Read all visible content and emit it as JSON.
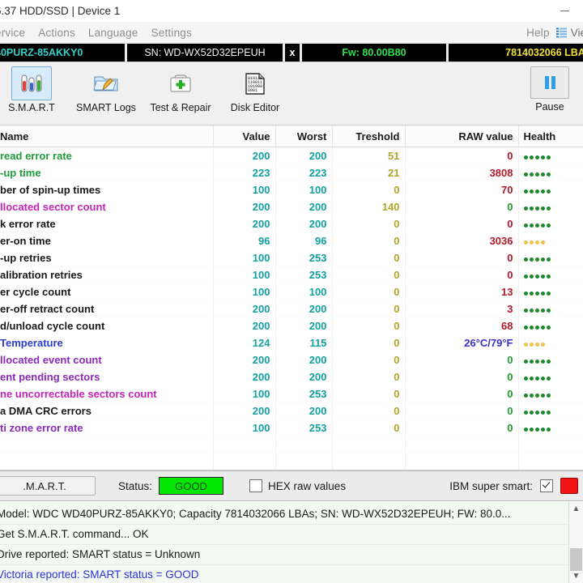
{
  "window": {
    "title": "6.37 HDD/SSD | Device 1",
    "minimize_glyph": "minimize-icon"
  },
  "menu": {
    "items": [
      "ervice",
      "Actions",
      "Language",
      "Settings",
      "Help"
    ],
    "view_label": "Vie",
    "view_icon": "list-icon"
  },
  "drive_bar": {
    "model": "40PURZ-85AKKY0",
    "serial": "SN: WD-WX52D32EPEUH",
    "close_label": "x",
    "firmware": "Fw: 80.00B80",
    "capacity": "7814032066 LBA ("
  },
  "toolbar": {
    "buttons": [
      {
        "label": "S.M.A.R.T",
        "icon": "test-tubes-icon",
        "active": true
      },
      {
        "label": "SMART Logs",
        "icon": "folder-pencil-icon",
        "active": false
      },
      {
        "label": "Test & Repair",
        "icon": "first-aid-icon",
        "active": false
      },
      {
        "label": "Disk Editor",
        "icon": "binary-page-icon",
        "active": false
      }
    ],
    "pause": {
      "label": "Pause",
      "icon": "pause-icon"
    }
  },
  "table": {
    "columns": [
      "Name",
      "Value",
      "Worst",
      "Treshold",
      "RAW value",
      "Health"
    ],
    "rows": [
      {
        "name": " read error rate",
        "color": "nm-green",
        "value": "200",
        "worst": "200",
        "threshold": "51",
        "raw": "0",
        "raw_color": "raw-red",
        "health": 5,
        "health_color": "green"
      },
      {
        "name": "-up time",
        "color": "nm-green",
        "value": "223",
        "worst": "223",
        "threshold": "21",
        "raw": "3808",
        "raw_color": "raw-red",
        "health": 5,
        "health_color": "green"
      },
      {
        "name": "ber of spin-up times",
        "color": "nm-black",
        "value": "100",
        "worst": "100",
        "threshold": "0",
        "raw": "70",
        "raw_color": "raw-red",
        "health": 5,
        "health_color": "green"
      },
      {
        "name": "llocated sector count",
        "color": "nm-magenta",
        "value": "200",
        "worst": "200",
        "threshold": "140",
        "raw": "0",
        "raw_color": "raw-green",
        "health": 5,
        "health_color": "green"
      },
      {
        "name": "k error rate",
        "color": "nm-black",
        "value": "200",
        "worst": "200",
        "threshold": "0",
        "raw": "0",
        "raw_color": "raw-red",
        "health": 5,
        "health_color": "green"
      },
      {
        "name": "er-on time",
        "color": "nm-black",
        "value": "96",
        "worst": "96",
        "threshold": "0",
        "raw": "3036",
        "raw_color": "raw-red",
        "health": 4,
        "health_color": "orange"
      },
      {
        "name": "-up retries",
        "color": "nm-black",
        "value": "100",
        "worst": "253",
        "threshold": "0",
        "raw": "0",
        "raw_color": "raw-red",
        "health": 5,
        "health_color": "green"
      },
      {
        "name": "alibration retries",
        "color": "nm-black",
        "value": "100",
        "worst": "253",
        "threshold": "0",
        "raw": "0",
        "raw_color": "raw-red",
        "health": 5,
        "health_color": "green"
      },
      {
        "name": "er cycle count",
        "color": "nm-black",
        "value": "100",
        "worst": "100",
        "threshold": "0",
        "raw": "13",
        "raw_color": "raw-red",
        "health": 5,
        "health_color": "green"
      },
      {
        "name": "er-off retract count",
        "color": "nm-black",
        "value": "200",
        "worst": "200",
        "threshold": "0",
        "raw": "3",
        "raw_color": "raw-red",
        "health": 5,
        "health_color": "green"
      },
      {
        "name": "d/unload cycle count",
        "color": "nm-black",
        "value": "200",
        "worst": "200",
        "threshold": "0",
        "raw": "68",
        "raw_color": "raw-red",
        "health": 5,
        "health_color": "green"
      },
      {
        "name": " Temperature",
        "color": "nm-blue",
        "value": "124",
        "worst": "115",
        "threshold": "0",
        "raw": "26°C/79°F",
        "raw_color": "raw-blue",
        "health": 4,
        "health_color": "orange"
      },
      {
        "name": "llocated event count",
        "color": "nm-purple",
        "value": "200",
        "worst": "200",
        "threshold": "0",
        "raw": "0",
        "raw_color": "raw-green",
        "health": 5,
        "health_color": "green"
      },
      {
        "name": "ent pending sectors",
        "color": "nm-purple",
        "value": "200",
        "worst": "200",
        "threshold": "0",
        "raw": "0",
        "raw_color": "raw-green",
        "health": 5,
        "health_color": "green"
      },
      {
        "name": "ne uncorrectable sectors count",
        "color": "nm-magenta",
        "value": "100",
        "worst": "253",
        "threshold": "0",
        "raw": "0",
        "raw_color": "raw-green",
        "health": 5,
        "health_color": "green"
      },
      {
        "name": "a DMA CRC errors",
        "color": "nm-black",
        "value": "200",
        "worst": "200",
        "threshold": "0",
        "raw": "0",
        "raw_color": "raw-green",
        "health": 5,
        "health_color": "green"
      },
      {
        "name": "ti zone error rate",
        "color": "nm-purple",
        "value": "100",
        "worst": "253",
        "threshold": "0",
        "raw": "0",
        "raw_color": "raw-green",
        "health": 5,
        "health_color": "green"
      }
    ]
  },
  "statusbar": {
    "get_smart_label": ".M.A.R.T.",
    "status_label": "Status:",
    "status_value": "GOOD",
    "hex_label": "HEX raw values",
    "hex_checked": false,
    "ibm_label": "IBM super smart:",
    "ibm_checked": true,
    "led_color": "#f21414"
  },
  "log": {
    "lines": [
      {
        "text": "Model: WDC WD40PURZ-85AKKY0; Capacity 7814032066 LBAs; SN: WD-WX52D32EPEUH; FW: 80.0...",
        "blue": false
      },
      {
        "text": "Get S.M.A.R.T. command... OK",
        "blue": false
      },
      {
        "text": "Drive reported: SMART status = Unknown",
        "blue": false
      },
      {
        "text": "Victoria reported: SMART status = GOOD",
        "blue": true
      }
    ],
    "scroll_up": "▲",
    "scroll_down": "▼"
  },
  "colors": {
    "accent_blue": "#2f9fe8",
    "status_green": "#00e800",
    "led_red": "#f21414",
    "value_teal": "#12a0a0",
    "threshold_olive": "#b0a526",
    "raw_red": "#b01a2a"
  }
}
